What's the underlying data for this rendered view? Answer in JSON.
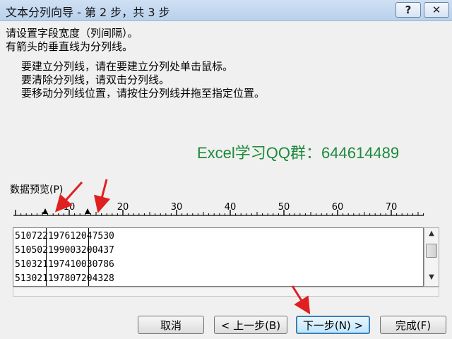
{
  "window": {
    "title": "文本分列向导 - 第 2 步，共 3 步",
    "help_label": "?",
    "close_label": "✕"
  },
  "instructions": {
    "line1": "请设置字段宽度（列间隔）。",
    "line2": "有箭头的垂直线为分列线。",
    "bullets": [
      "要建立分列线，请在要建立分列处单击鼠标。",
      "要清除分列线，请双击分列线。",
      "要移动分列线位置，请按住分列线并拖至指定位置。"
    ]
  },
  "watermark": "Excel学习QQ群：644614489",
  "preview": {
    "label": "数据预览(P)",
    "ruler_labels": [
      "10",
      "20",
      "30",
      "40",
      "50",
      "60",
      "70"
    ],
    "rows": [
      "510722197612047530",
      "510502199003200437",
      "510321197410030786",
      "513021197807204328"
    ],
    "break_columns": [
      6,
      14
    ]
  },
  "buttons": {
    "cancel": "取消",
    "back": "< 上一步(B)",
    "next": "下一步(N) >",
    "finish": "完成(F)"
  },
  "colors": {
    "watermark": "#1d8a3a",
    "annotation_arrow": "#e02020"
  }
}
